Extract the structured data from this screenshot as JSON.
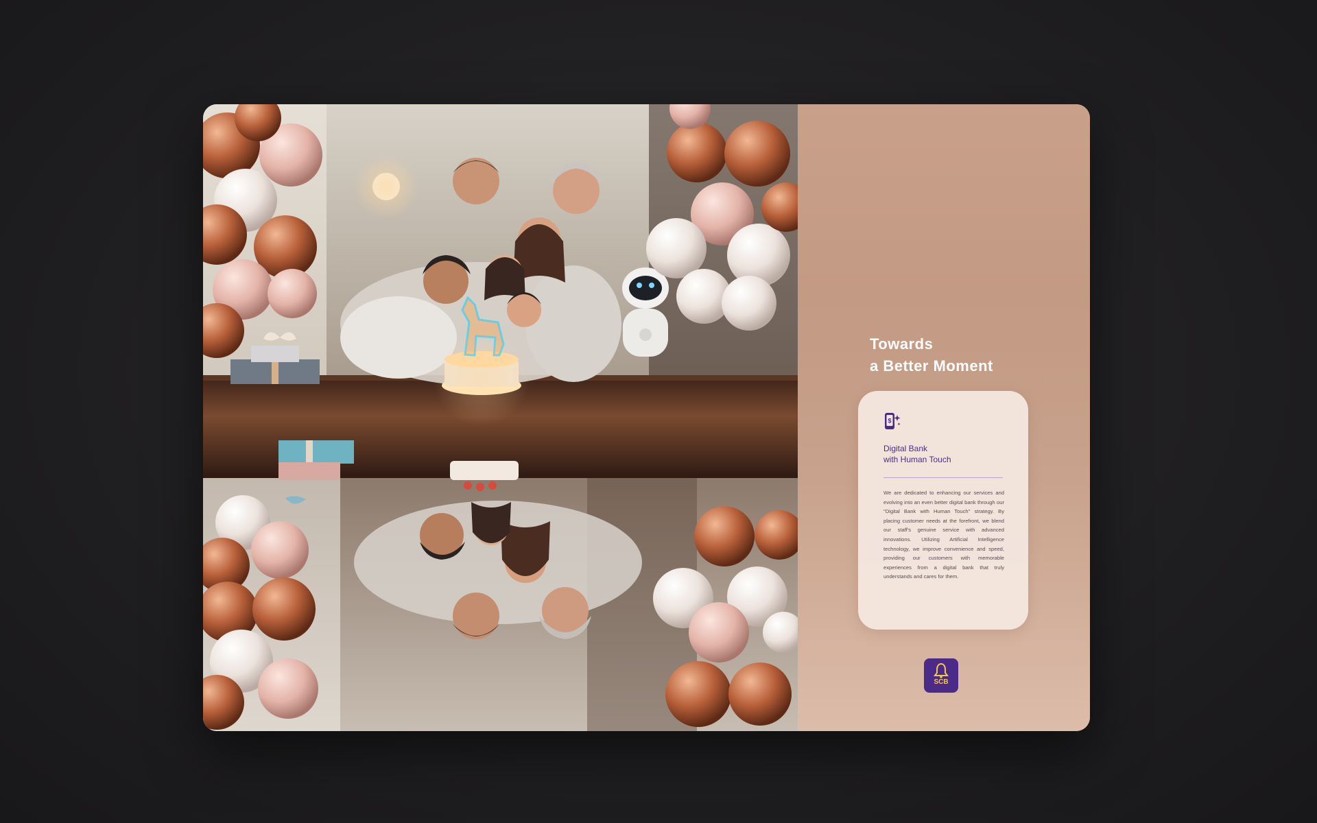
{
  "headline": {
    "line1": "Towards",
    "line2": "a Better Moment"
  },
  "info_card": {
    "icon": "mobile-bank-sparkle-icon",
    "title_line1": "Digital Bank",
    "title_line2": "with Human Touch",
    "body": "We are dedicated to enhancing our services and evolving into an even better digital bank through our \"Digital Bank with Human Touch\" strategy. By placing customer needs at the forefront, we blend our staff's genuine service with advanced innovations. Utilizing Artificial Intelligence technology, we improve convenience and speed, providing our customers with memorable experiences from a digital bank that truly understands and cares for them."
  },
  "logo": {
    "text": "SCB",
    "icon": "bell-logo-icon"
  },
  "colors": {
    "background": "#1f1e20",
    "panel": "#c9a08a",
    "accent_purple": "#4b2a88",
    "logo_gold": "#f3c94a"
  }
}
